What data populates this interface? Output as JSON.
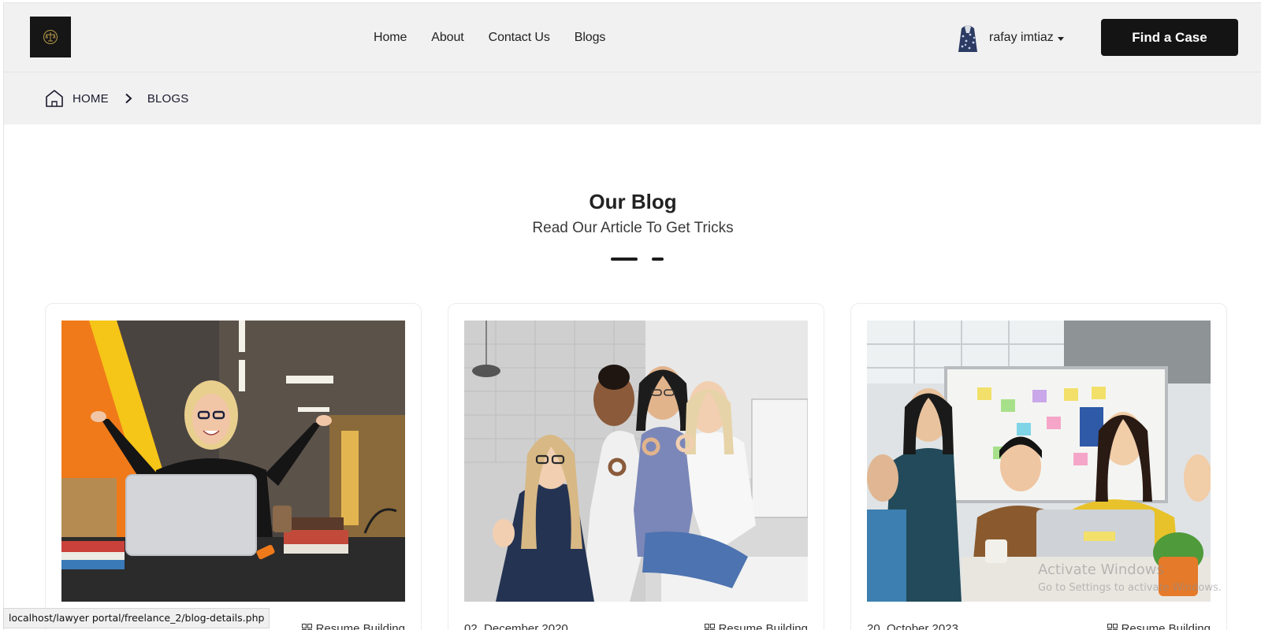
{
  "header": {
    "nav": [
      "Home",
      "About",
      "Contact Us",
      "Blogs"
    ],
    "user_name": "rafay imtiaz",
    "cta_label": "Find a Case"
  },
  "breadcrumb": {
    "home": "HOME",
    "current": "BLOGS"
  },
  "section": {
    "title": "Our Blog",
    "subtitle": "Read Our Article To Get Tricks"
  },
  "posts": [
    {
      "date": "",
      "category": "Resume Building",
      "photo": "woman-with-laptop"
    },
    {
      "date": "02, December 2020",
      "category": "Resume Building",
      "photo": "group-ok-gesture"
    },
    {
      "date": "20, October 2023",
      "category": "Resume Building",
      "photo": "team-celebrating"
    }
  ],
  "status_url": "localhost/lawyer portal/freelance_2/blog-details.php",
  "windows_watermark": {
    "line1": "Activate Windows",
    "line2": "Go to Settings to activate Windows."
  },
  "colors": {
    "bar_bg": "#f1f1f1",
    "cta_bg": "#141414",
    "text": "#222222"
  }
}
